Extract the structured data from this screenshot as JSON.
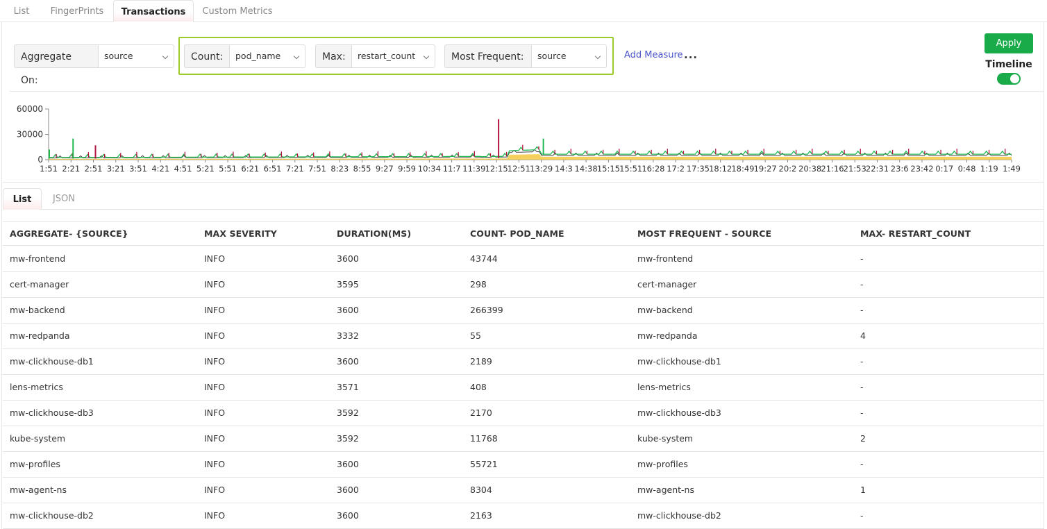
{
  "top_tabs": [
    "List",
    "FingerPrints",
    "Transactions",
    "Custom Metrics"
  ],
  "active_top_tab": "Transactions",
  "controls": {
    "aggregate_label": "Aggregate On:",
    "aggregate_value": "source",
    "count_label": "Count:",
    "count_value": "pod_name",
    "max_label": "Max:",
    "max_value": "restart_count",
    "most_frequent_label": "Most Frequent:",
    "most_frequent_value": "source",
    "add_measure": "Add Measure",
    "more": "...",
    "apply": "Apply",
    "timeline_label": "Timeline",
    "timeline_on": true
  },
  "chart_data": {
    "type": "area",
    "y_ticks": [
      "60000",
      "30000",
      "0"
    ],
    "ylim": [
      0,
      60000
    ],
    "x_ticks": [
      "1:51",
      "2:21",
      "2:51",
      "3:21",
      "3:51",
      "4:21",
      "4:51",
      "5:21",
      "5:51",
      "6:21",
      "6:51",
      "7:21",
      "7:51",
      "8:23",
      "8:55",
      "9:27",
      "9:59",
      "10:34",
      "11:7",
      "11:39",
      "12:15",
      "12:51",
      "13:29",
      "14:3",
      "14:38",
      "15:15",
      "15:51",
      "16:28",
      "17:2",
      "17:35",
      "18:12",
      "18:49",
      "19:27",
      "20:2",
      "20:38",
      "21:16",
      "21:53",
      "22:31",
      "23:6",
      "23:42",
      "0:17",
      "0:48",
      "1:19",
      "1:49"
    ],
    "colors": {
      "yellow": "#f5c842",
      "green": "#1fb84f",
      "crimson": "#b3123f",
      "dark": "#444444"
    },
    "spikes": [
      {
        "x": "1:51",
        "series": "green",
        "value": 12000
      },
      {
        "x": "2:21",
        "series": "green",
        "value": 25000
      },
      {
        "x": "2:51",
        "series": "crimson",
        "value": 17000
      },
      {
        "x": "12:15",
        "series": "crimson",
        "value": 48000
      },
      {
        "x": "13:29",
        "series": "green",
        "value": 25000
      }
    ]
  },
  "sub_tabs": [
    "List",
    "JSON"
  ],
  "active_sub_tab": "List",
  "table": {
    "headers": [
      "AGGREGATE- {SOURCE}",
      "MAX SEVERITY",
      "DURATION(MS)",
      "COUNT- POD_NAME",
      "MOST FREQUENT - SOURCE",
      "MAX- RESTART_COUNT"
    ],
    "rows": [
      [
        "mw-frontend",
        "INFO",
        "3600",
        "43744",
        "mw-frontend",
        "-"
      ],
      [
        "cert-manager",
        "INFO",
        "3595",
        "298",
        "cert-manager",
        "-"
      ],
      [
        "mw-backend",
        "INFO",
        "3600",
        "266399",
        "mw-backend",
        "-"
      ],
      [
        "mw-redpanda",
        "INFO",
        "3332",
        "55",
        "mw-redpanda",
        "4"
      ],
      [
        "mw-clickhouse-db1",
        "INFO",
        "3600",
        "2189",
        "mw-clickhouse-db1",
        "-"
      ],
      [
        "lens-metrics",
        "INFO",
        "3571",
        "408",
        "lens-metrics",
        "-"
      ],
      [
        "mw-clickhouse-db3",
        "INFO",
        "3592",
        "2170",
        "mw-clickhouse-db3",
        "-"
      ],
      [
        "kube-system",
        "INFO",
        "3592",
        "11768",
        "kube-system",
        "2"
      ],
      [
        "mw-profiles",
        "INFO",
        "3600",
        "55721",
        "mw-profiles",
        "-"
      ],
      [
        "mw-agent-ns",
        "INFO",
        "3600",
        "8304",
        "mw-agent-ns",
        "1"
      ],
      [
        "mw-clickhouse-db2",
        "INFO",
        "3600",
        "2163",
        "mw-clickhouse-db2",
        "-"
      ]
    ]
  }
}
